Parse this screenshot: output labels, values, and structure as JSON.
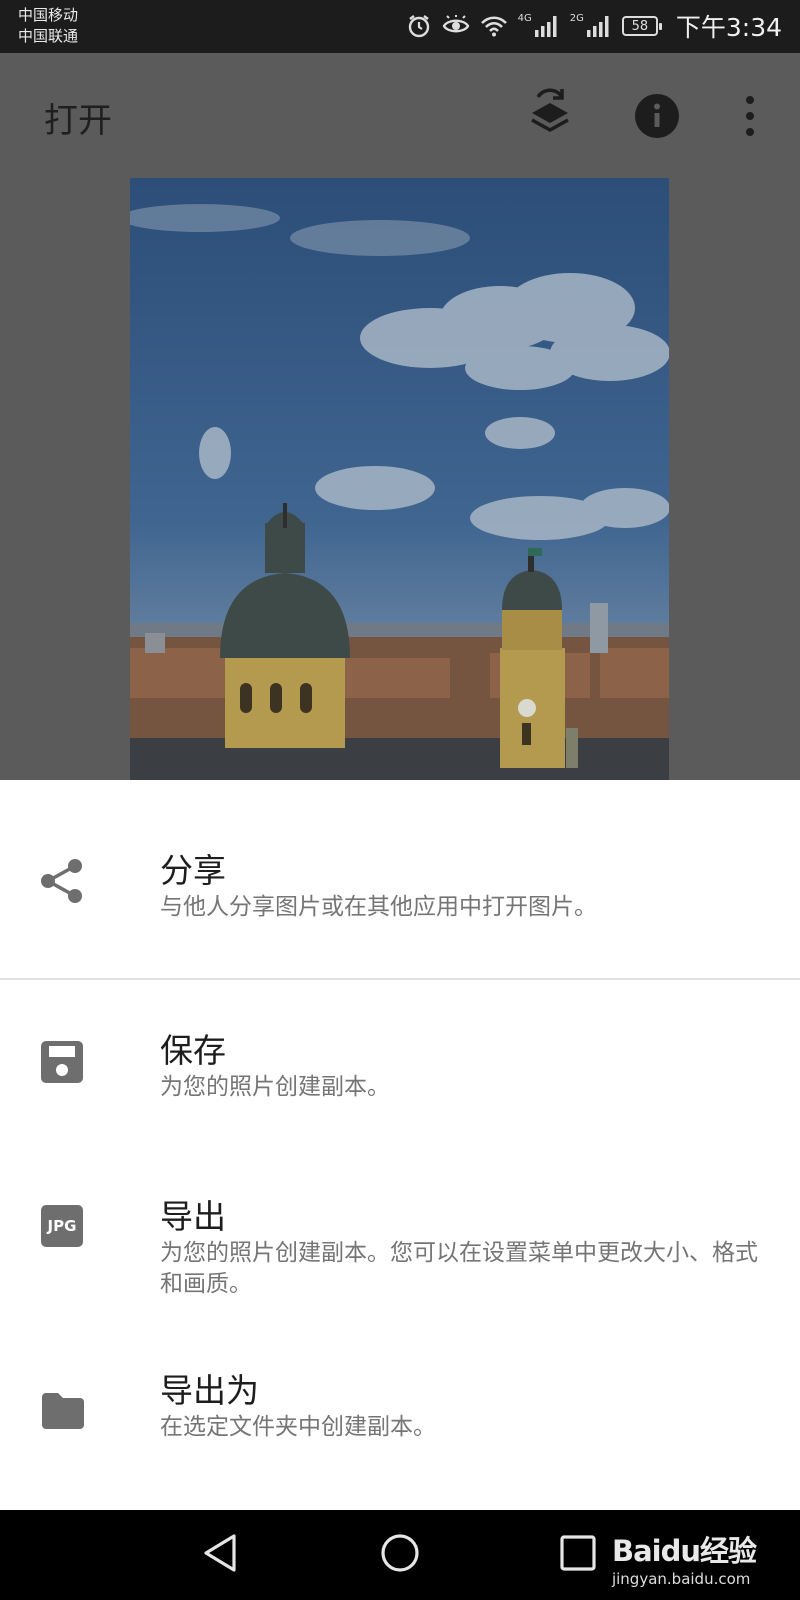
{
  "status_bar": {
    "carrier_1": "中国移动",
    "carrier_2": "中国联通",
    "network_1": "4G",
    "network_2": "2G",
    "battery": "58",
    "time": "下午3:34",
    "icons": [
      "alarm-icon",
      "eye-comfort-icon",
      "wifi-icon",
      "signal-icon",
      "signal-icon",
      "battery-icon"
    ]
  },
  "toolbar": {
    "title": "打开",
    "icons": [
      "layers-swap-icon",
      "info-icon",
      "more-vert-icon"
    ]
  },
  "photo": {
    "subject": "city-domes-sky-image"
  },
  "sheet": {
    "items": [
      {
        "icon": "share-icon",
        "title": "分享",
        "description": "与他人分享图片或在其他应用中打开图片。"
      },
      {
        "icon": "save-icon",
        "title": "保存",
        "description": "为您的照片创建副本。"
      },
      {
        "icon": "jpg-icon",
        "icon_text": "JPG",
        "title": "导出",
        "description": "为您的照片创建副本。您可以在设置菜单中更改大小、格式和画质。"
      },
      {
        "icon": "folder-icon",
        "title": "导出为",
        "description": "在选定文件夹中创建副本。"
      }
    ]
  },
  "navbar": {
    "buttons": [
      "back-icon",
      "home-icon",
      "recents-icon"
    ],
    "watermark_main": "Baidu经验",
    "watermark_url": "jingyan.baidu.com"
  },
  "colors": {
    "overlay": "#5b5b5b",
    "sheet_bg": "#ffffff",
    "icon_gray": "#6e6e6e",
    "title_text": "#1d1d1d",
    "desc_text": "#757575"
  }
}
